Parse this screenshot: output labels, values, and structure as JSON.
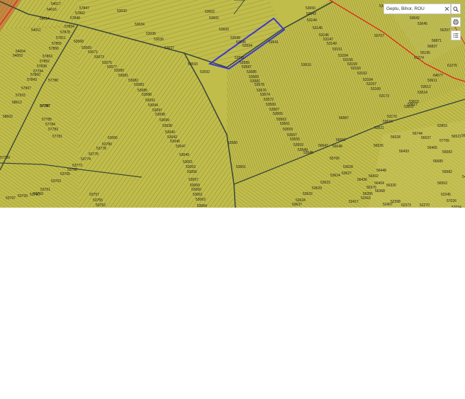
{
  "search": {
    "value": "Geplu, Bihor, ROU"
  },
  "controls": {
    "clear_icon": "close-icon",
    "search_icon": "search-icon",
    "layer_icon": "print-icon",
    "list_icon": "list-icon"
  },
  "colors": {
    "field": "#c3bf4a",
    "field_alt": "#b3ad3f",
    "road": "#3d4a3a",
    "boundary_red": "#e0201a",
    "selected_parcel": "#3a3acf",
    "light_parcel": "#d9db78"
  },
  "parcel_labels": [
    "54017",
    "54016",
    "54014",
    "54011",
    "54004",
    "54003",
    "57847",
    "57862",
    "57848",
    "57854",
    "57878",
    "57811",
    "57855",
    "57856",
    "57863",
    "57852",
    "57838",
    "57794",
    "57860",
    "57843",
    "57907",
    "57915",
    "58612",
    "58602",
    "57786",
    "57785",
    "57784",
    "57783",
    "57781",
    "57789",
    "57788",
    "57787",
    "53033",
    "53034",
    "53035",
    "53036",
    "53037",
    "53068",
    "53069",
    "53071",
    "53073",
    "53075",
    "53077",
    "53080",
    "53081",
    "53082",
    "53083",
    "53085",
    "53088",
    "53091",
    "53094",
    "53097",
    "53098",
    "53099",
    "53038",
    "53040",
    "53042",
    "53045",
    "53047",
    "53049",
    "53051",
    "53053",
    "53056",
    "53057",
    "53059",
    "53060",
    "53061",
    "53063",
    "53064",
    "53065",
    "53780",
    "53778",
    "53776",
    "53774",
    "53773",
    "53768",
    "53765",
    "53763",
    "53761",
    "53759",
    "53757",
    "53755",
    "53752",
    "53797",
    "53793",
    "53790",
    "53602",
    "53601",
    "53600",
    "53598",
    "53596",
    "53594",
    "53593",
    "53592",
    "53591",
    "53589",
    "53587",
    "53585",
    "53583",
    "53581",
    "53578",
    "53576",
    "53574",
    "53572",
    "53569",
    "53567",
    "53565",
    "53563",
    "53561",
    "53559",
    "53557",
    "53555",
    "53553",
    "53549",
    "53545",
    "53541",
    "53580",
    "53651",
    "53650",
    "53143",
    "53144",
    "53145",
    "53146",
    "53147",
    "53149",
    "53151",
    "53154",
    "53156",
    "53159",
    "53160",
    "53162",
    "53164",
    "53167",
    "53169",
    "53173",
    "53176",
    "53619",
    "53621",
    "53622",
    "53617",
    "53615",
    "53614",
    "53612",
    "53611",
    "53610",
    "56987",
    "56652",
    "56648",
    "56647",
    "55766",
    "53628",
    "53627",
    "53624",
    "53623",
    "53629",
    "53632",
    "53634",
    "53637",
    "53639",
    "53641",
    "53642",
    "53645",
    "50707",
    "56257",
    "56871",
    "56837",
    "55195",
    "61274",
    "61276",
    "64577",
    "62803",
    "56744",
    "56637",
    "57765",
    "56521",
    "56523",
    "56528",
    "56535",
    "56493",
    "56465",
    "55583",
    "56680",
    "55682",
    "56563",
    "56448",
    "56432",
    "56436",
    "56404",
    "56376",
    "56368",
    "56355",
    "56320",
    "52417",
    "52416",
    "52407",
    "52398",
    "52373",
    "52270",
    "52245",
    "57026",
    "57024",
    "56745",
    "54414",
    "54413",
    "56689",
    "57114",
    "55344",
    "57062",
    "57224",
    "57228",
    "53343",
    "52529",
    "56802",
    "56781",
    "56760",
    "50804"
  ]
}
